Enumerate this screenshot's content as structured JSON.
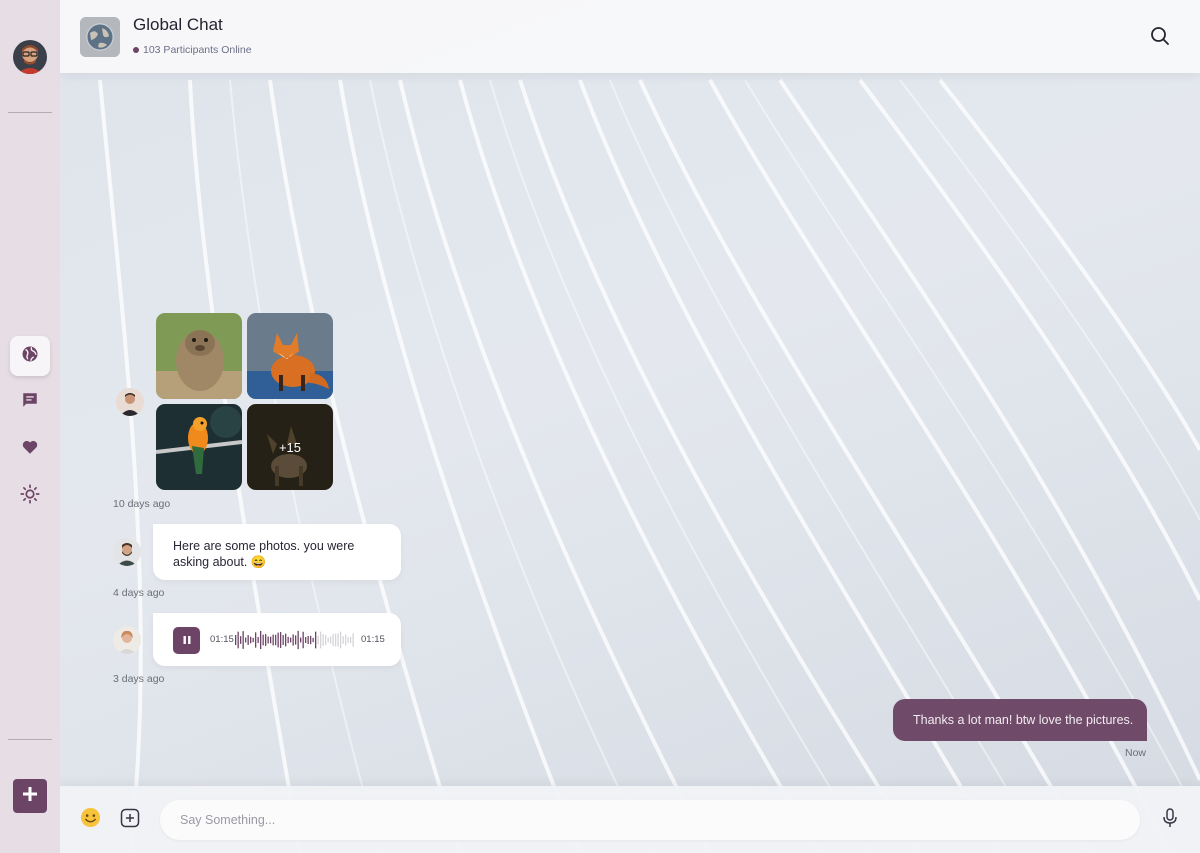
{
  "sidebar": {
    "user_avatar": "user-avatar",
    "nav": [
      {
        "icon": "globe-icon",
        "active": true
      },
      {
        "icon": "chat-icon",
        "active": false
      },
      {
        "icon": "heart-icon",
        "active": false
      },
      {
        "icon": "sun-icon",
        "active": false
      }
    ],
    "add_icon": "plus-icon"
  },
  "header": {
    "title": "Global Chat",
    "status": "103 Participants Online",
    "search_icon": "search-icon"
  },
  "messages": [
    {
      "type": "photos",
      "photos": [
        "marmot",
        "fox",
        "parrot",
        "deer"
      ],
      "more": "+15",
      "time": "10 days ago"
    },
    {
      "type": "text",
      "text": "Here are some photos. you were asking about. 😄",
      "time": "4 days ago"
    },
    {
      "type": "voice",
      "elapsed": "01:15",
      "duration": "01:15",
      "time": "3 days ago"
    },
    {
      "type": "own",
      "text": "Thanks a lot man! btw love the pictures.",
      "time": "Now"
    }
  ],
  "composer": {
    "emoji_icon": "emoji-icon",
    "attach_icon": "add-attachment-icon",
    "placeholder": "Say Something...",
    "mic_icon": "microphone-icon"
  },
  "colors": {
    "accent": "#6c4566",
    "sidebar_bg": "#e7dde4",
    "own_bubble": "#704b69"
  }
}
